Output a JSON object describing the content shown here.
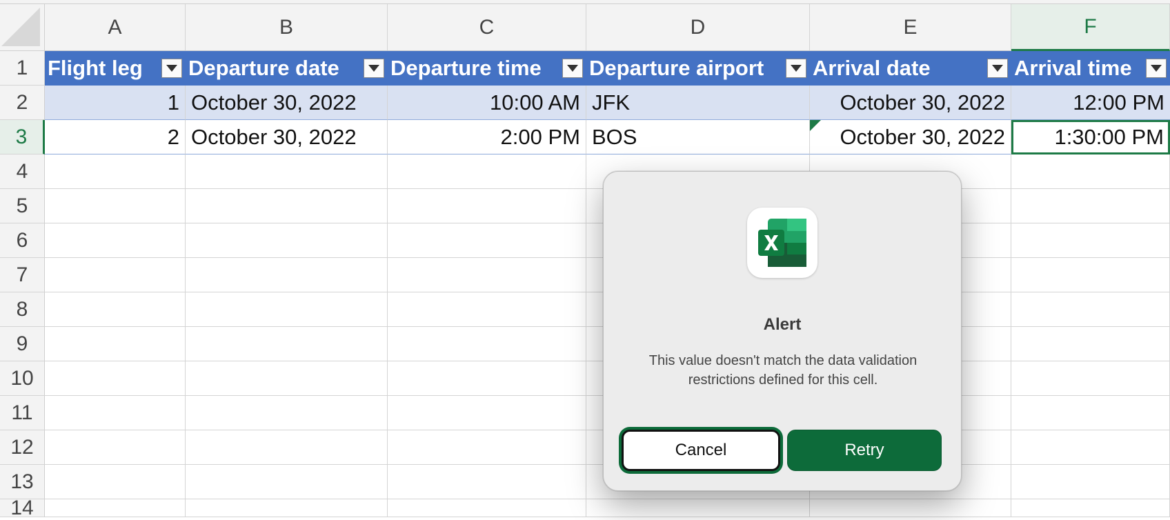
{
  "columns": [
    "A",
    "B",
    "C",
    "D",
    "E",
    "F"
  ],
  "rows": [
    "1",
    "2",
    "3",
    "4",
    "5",
    "6",
    "7",
    "8",
    "9",
    "10",
    "11",
    "12",
    "13",
    "14"
  ],
  "table": {
    "headers": [
      "Flight leg",
      "Departure date",
      "Departure time",
      "Departure airport",
      "Arrival date",
      "Arrival time"
    ],
    "rows": [
      [
        "1",
        "October 30, 2022",
        "10:00 AM",
        "JFK",
        "October 30, 2022",
        "12:00 PM"
      ],
      [
        "2",
        "October 30, 2022",
        "2:00 PM",
        "BOS",
        "October 30, 2022",
        "1:30:00 PM"
      ]
    ]
  },
  "selection": {
    "column": "F",
    "row": "3"
  },
  "dialog": {
    "icon": "excel-app-icon",
    "title": "Alert",
    "message": "This value doesn't match the data validation restrictions defined for this cell.",
    "cancel_label": "Cancel",
    "retry_label": "Retry"
  },
  "colors": {
    "table_header": "#4472c4",
    "band": "#d9e1f2",
    "excel_green": "#0d6b3a"
  }
}
